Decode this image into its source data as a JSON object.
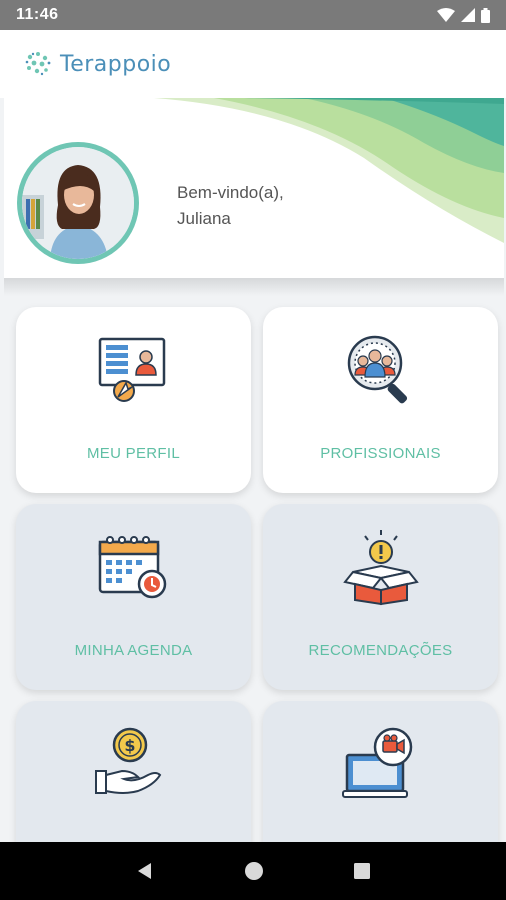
{
  "status_bar": {
    "time": "11:46"
  },
  "app_bar": {
    "title": "Terappoio"
  },
  "hero": {
    "greeting": "Bem-vindo(a),",
    "user_name": "Juliana"
  },
  "menu": {
    "cards": [
      {
        "label": "MEU PERFIL",
        "icon": "profile-board-icon"
      },
      {
        "label": "PROFISSIONAIS",
        "icon": "professionals-search-icon"
      },
      {
        "label": "MINHA AGENDA",
        "icon": "calendar-icon"
      },
      {
        "label": "RECOMENDAÇÕES",
        "icon": "recommendation-box-icon"
      },
      {
        "label": "",
        "icon": "payment-hand-icon"
      },
      {
        "label": "",
        "icon": "video-call-icon"
      }
    ]
  },
  "colors": {
    "accent": "#5fbfa4",
    "brand": "#4b8fb8",
    "card_grey": "#e3e8ee"
  }
}
